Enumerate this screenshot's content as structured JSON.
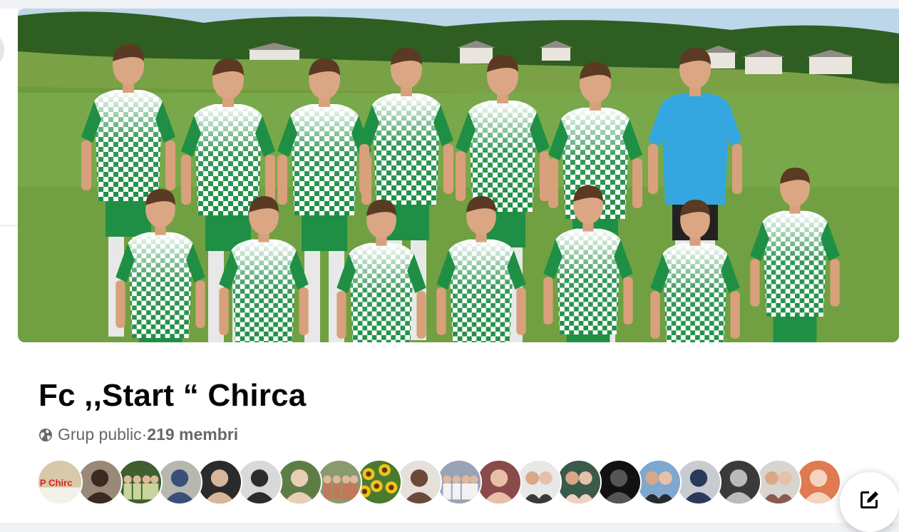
{
  "group": {
    "name": "Fc ,,Start “ Chirca",
    "privacy": "Grup public",
    "separator": " · ",
    "members": "219 membri"
  },
  "cover": {
    "icon": "team-photo",
    "sky_color": "#bcd6ea",
    "grass_color": "#6f9a3c",
    "jersey_color": "#1f8f45",
    "keeper_color": "#35a7e0"
  },
  "avatars": [
    {
      "icon": "avatar-text-logo",
      "text": "P Chirc",
      "bg": "#d8c9a8",
      "fg": "#e02020"
    },
    {
      "icon": "avatar-person",
      "bg": "#9a8878",
      "fg": "#3a2b22"
    },
    {
      "icon": "avatar-group-outdoor",
      "bg": "#3f5f2e",
      "fg": "#c9d59a"
    },
    {
      "icon": "avatar-person",
      "bg": "#b7b7b0",
      "fg": "#3a4f7a"
    },
    {
      "icon": "avatar-person",
      "bg": "#2b2b2b",
      "fg": "#d8b69a"
    },
    {
      "icon": "avatar-person",
      "bg": "#d9d9d9",
      "fg": "#2c2c2c"
    },
    {
      "icon": "avatar-person",
      "bg": "#5e7d45",
      "fg": "#e8cfb3"
    },
    {
      "icon": "avatar-group-outdoor",
      "bg": "#8a9a6e",
      "fg": "#c07a5a"
    },
    {
      "icon": "avatar-sunflowers",
      "bg": "#4a7a2e",
      "fg": "#f2c21b"
    },
    {
      "icon": "avatar-person",
      "bg": "#e6e0da",
      "fg": "#6b4a3a"
    },
    {
      "icon": "avatar-group-indoor",
      "bg": "#9aa2b8",
      "fg": "#f2f2f2"
    },
    {
      "icon": "avatar-person",
      "bg": "#8a4a4a",
      "fg": "#e8c0a8"
    },
    {
      "icon": "avatar-couple",
      "bg": "#e8e8e8",
      "fg": "#3a3a3a"
    },
    {
      "icon": "avatar-couple",
      "bg": "#3a5a4a",
      "fg": "#f0d0c0"
    },
    {
      "icon": "avatar-person",
      "bg": "#111111",
      "fg": "#555555"
    },
    {
      "icon": "avatar-couple",
      "bg": "#7fa8cf",
      "fg": "#2a2a2a"
    },
    {
      "icon": "avatar-person",
      "bg": "#c8ccd0",
      "fg": "#2a3a5a"
    },
    {
      "icon": "avatar-person",
      "bg": "#3a3a3a",
      "fg": "#bbbbbb"
    },
    {
      "icon": "avatar-couple",
      "bg": "#d8d4cf",
      "fg": "#8a5a4a"
    },
    {
      "icon": "avatar-person",
      "bg": "#e07a50",
      "fg": "#f4d4c0"
    }
  ],
  "actions": {
    "edit_icon": "edit-icon"
  }
}
